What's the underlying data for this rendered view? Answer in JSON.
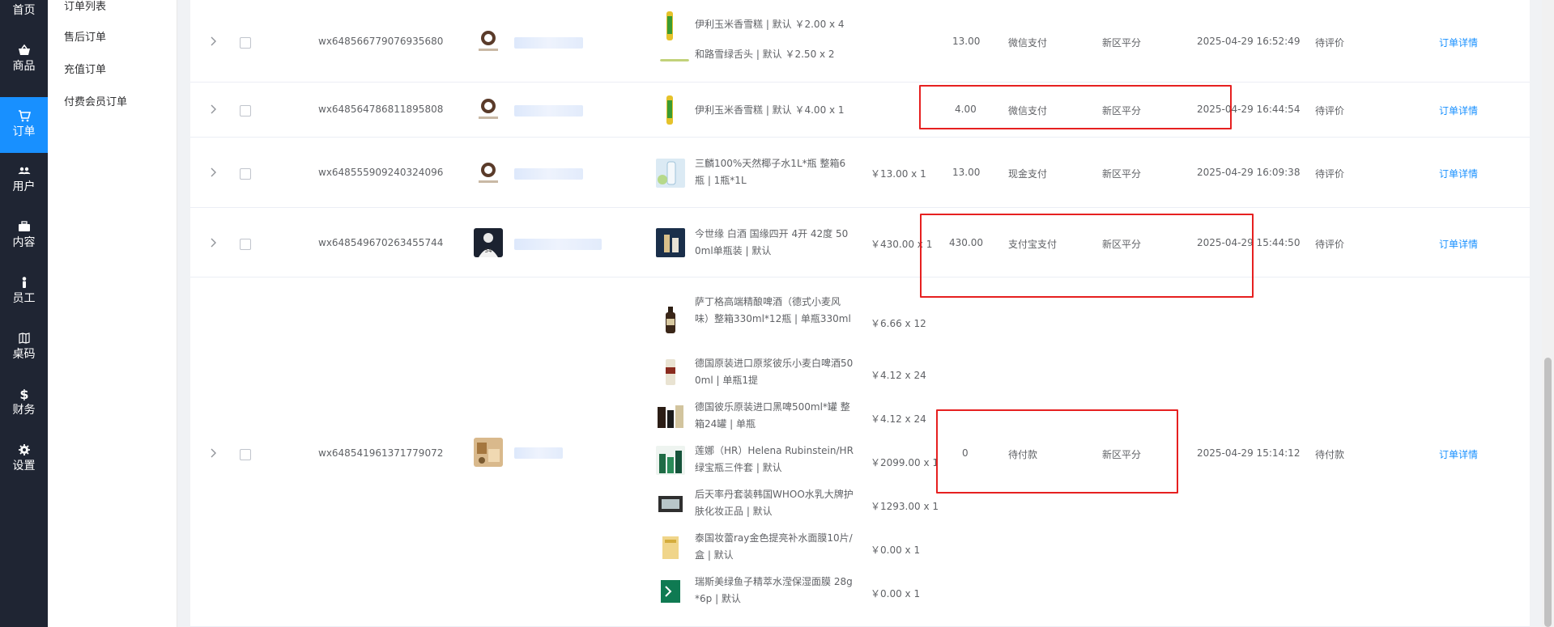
{
  "nav": {
    "items": [
      {
        "key": "home",
        "label": "首页",
        "icon": "home-icon"
      },
      {
        "key": "goods",
        "label": "商品",
        "icon": "basket-icon"
      },
      {
        "key": "orders",
        "label": "订单",
        "icon": "cart-icon",
        "active": true
      },
      {
        "key": "users",
        "label": "用户",
        "icon": "users-icon"
      },
      {
        "key": "content",
        "label": "内容",
        "icon": "briefcase-icon"
      },
      {
        "key": "staff",
        "label": "员工",
        "icon": "person-icon"
      },
      {
        "key": "tables",
        "label": "桌码",
        "icon": "map-icon"
      },
      {
        "key": "finance",
        "label": "财务",
        "icon": "dollar-icon"
      },
      {
        "key": "settings",
        "label": "设置",
        "icon": "gear-icon"
      }
    ]
  },
  "submenu": {
    "items": [
      "订单列表",
      "售后订单",
      "充值订单",
      "付费会员订单"
    ]
  },
  "orders": [
    {
      "order_no": "wx648566779076935680",
      "products": [
        {
          "name": "伊利玉米香雪糕 | 默认 ￥2.00 x 4",
          "price": ""
        },
        {
          "name": "和路雪绿舌头 | 默认 ￥2.50 x 2",
          "price": ""
        }
      ],
      "amount": "13.00",
      "pay_method": "微信支付",
      "store": "新区平分",
      "time": "2025-04-29 16:52:49",
      "status": "待评价",
      "action": "订单详情"
    },
    {
      "order_no": "wx648564786811895808",
      "products": [
        {
          "name": "伊利玉米香雪糕 | 默认 ￥4.00 x 1",
          "price": ""
        }
      ],
      "amount": "4.00",
      "pay_method": "微信支付",
      "store": "新区平分",
      "time": "2025-04-29 16:44:54",
      "status": "待评价",
      "action": "订单详情"
    },
    {
      "order_no": "wx648555909240324096",
      "products": [
        {
          "name": "三麟100%天然椰子水1L*瓶 整箱6瓶 | 1瓶*1L",
          "price": "￥13.00 x 1"
        }
      ],
      "amount": "13.00",
      "pay_method": "现金支付",
      "store": "新区平分",
      "time": "2025-04-29 16:09:38",
      "status": "待评价",
      "action": "订单详情"
    },
    {
      "order_no": "wx648549670263455744",
      "products": [
        {
          "name": "今世缘 白酒 国缘四开 4开 42度 500ml单瓶装 | 默认",
          "price": "￥430.00 x 1"
        }
      ],
      "amount": "430.00",
      "pay_method": "支付宝支付",
      "store": "新区平分",
      "time": "2025-04-29 15:44:50",
      "status": "待评价",
      "action": "订单详情"
    },
    {
      "order_no": "wx648541961371779072",
      "products": [
        {
          "name": "萨丁格高端精酿啤酒（德式小麦风味）整箱330ml*12瓶 | 单瓶330ml",
          "price": "￥6.66 x 12"
        },
        {
          "name": "德国原装进口原浆彼乐小麦白啤酒500ml | 单瓶1提",
          "price": "￥4.12 x 24"
        },
        {
          "name": "德国彼乐原装进口黑啤500ml*罐 整箱24罐 | 单瓶",
          "price": "￥4.12 x 24"
        },
        {
          "name": "莲娜（HR）Helena Rubinstein/HR绿宝瓶三件套 | 默认",
          "price": "￥2099.00 x 1"
        },
        {
          "name": "后天率丹套装韩国WHOO水乳大牌护肤化妆正品 | 默认",
          "price": "￥1293.00 x 1"
        },
        {
          "name": "泰国妆蕾ray金色提亮补水面膜10片/盒 | 默认",
          "price": "￥0.00 x 1"
        },
        {
          "name": "瑞斯美绿鱼子精萃水滢保湿面膜 28g*6p | 默认",
          "price": "￥0.00 x 1"
        }
      ],
      "amount": "0",
      "pay_method": "待付款",
      "store": "新区平分",
      "time": "2025-04-29 15:14:12",
      "status": "待付款",
      "action": "订单详情"
    }
  ],
  "colors": {
    "nav_bg": "#1f2533",
    "active": "#1890ff",
    "highlight": "#e62020",
    "link": "#1890ff"
  }
}
